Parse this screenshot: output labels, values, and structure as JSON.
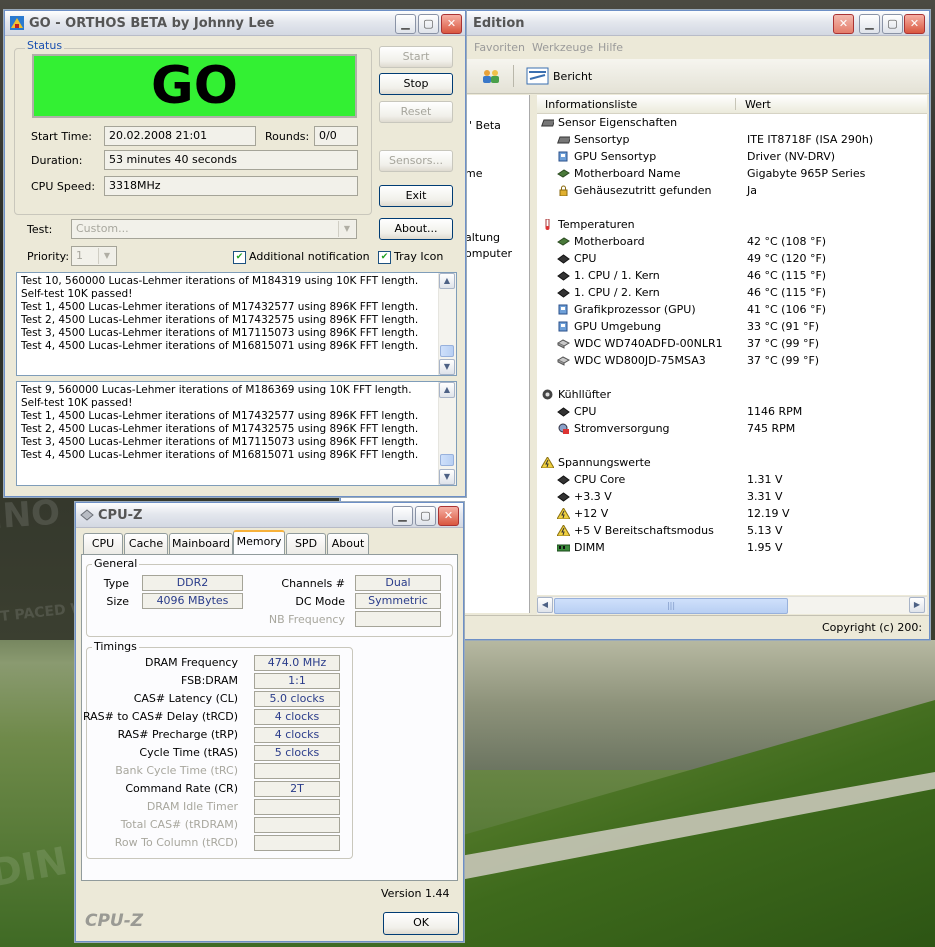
{
  "orthos": {
    "title": "GO - ORTHOS BETA by Johnny Lee",
    "status_label": "Status",
    "status_text": "GO",
    "start_label": "Start Time:",
    "start_value": "20.02.2008 21:01",
    "rounds_label": "Rounds:",
    "rounds_value": "0/0",
    "duration_label": "Duration:",
    "duration_value": "53 minutes 40 seconds",
    "speed_label": "CPU Speed:",
    "speed_value": "3318MHz",
    "buttons": {
      "start": "Start",
      "stop": "Stop",
      "reset": "Reset",
      "sensors": "Sensors...",
      "exit": "Exit",
      "about": "About..."
    },
    "test_label": "Test:",
    "test_value": "Custom...",
    "priority_label": "Priority:",
    "priority_value": "1",
    "notify_label": "Additional notification",
    "tray_label": "Tray Icon",
    "log1": [
      "Test 10, 560000 Lucas-Lehmer iterations of M184319 using 10K FFT length.",
      "Self-test 10K passed!",
      "Test 1, 4500 Lucas-Lehmer iterations of M17432577 using 896K FFT length.",
      "Test 2, 4500 Lucas-Lehmer iterations of M17432575 using 896K FFT length.",
      "Test 3, 4500 Lucas-Lehmer iterations of M17115073 using 896K FFT length.",
      "Test 4, 4500 Lucas-Lehmer iterations of M16815071 using 896K FFT length."
    ],
    "log2": [
      "Test 9, 560000 Lucas-Lehmer iterations of M186369 using 10K FFT length.",
      "Self-test 10K passed!",
      "Test 1, 4500 Lucas-Lehmer iterations of M17432577 using 896K FFT length.",
      "Test 2, 4500 Lucas-Lehmer iterations of M17432575 using 896K FFT length.",
      "Test 3, 4500 Lucas-Lehmer iterations of M17115073 using 896K FFT length.",
      "Test 4, 4500 Lucas-Lehmer iterations of M16815071 using 896K FFT length."
    ]
  },
  "everest": {
    "title_partial": "Edition",
    "menu": [
      "Favoriten",
      "Werkzeuge",
      "Hilfe"
    ],
    "toolbar_report": "Bericht",
    "tree_fragments": [
      "' Beta",
      "me",
      "altung",
      "omputer"
    ],
    "col_item": "Informationsliste",
    "col_value": "Wert",
    "status_copyright": "Copyright (c) 200:",
    "rows": [
      {
        "type": "group",
        "icon": "sensor",
        "label": "Sensor Eigenschaften",
        "value": ""
      },
      {
        "type": "item",
        "icon": "sensor",
        "label": "Sensortyp",
        "value": "ITE IT8718F  (ISA 290h)"
      },
      {
        "type": "item",
        "icon": "gpu",
        "label": "GPU Sensortyp",
        "value": "Driver  (NV-DRV)"
      },
      {
        "type": "item",
        "icon": "board",
        "label": "Motherboard Name",
        "value": "Gigabyte 965P Series"
      },
      {
        "type": "item",
        "icon": "lock",
        "label": "Gehäusezutritt gefunden",
        "value": "Ja"
      },
      {
        "type": "gap"
      },
      {
        "type": "group",
        "icon": "thermo",
        "label": "Temperaturen",
        "value": ""
      },
      {
        "type": "item",
        "icon": "board",
        "label": "Motherboard",
        "value": "42 °C  (108 °F)"
      },
      {
        "type": "item",
        "icon": "cpu",
        "label": "CPU",
        "value": "49 °C  (120 °F)"
      },
      {
        "type": "item",
        "icon": "cpu",
        "label": "1. CPU / 1. Kern",
        "value": "46 °C  (115 °F)"
      },
      {
        "type": "item",
        "icon": "cpu",
        "label": "1. CPU / 2. Kern",
        "value": "46 °C  (115 °F)"
      },
      {
        "type": "item",
        "icon": "gpu",
        "label": "Grafikprozessor (GPU)",
        "value": "41 °C  (106 °F)"
      },
      {
        "type": "item",
        "icon": "gpu",
        "label": "GPU Umgebung",
        "value": "33 °C  (91 °F)"
      },
      {
        "type": "item",
        "icon": "disk",
        "label": "WDC WD740ADFD-00NLR1",
        "value": "37 °C  (99 °F)"
      },
      {
        "type": "item",
        "icon": "disk",
        "label": "WDC WD800JD-75MSA3",
        "value": "37 °C  (99 °F)"
      },
      {
        "type": "gap"
      },
      {
        "type": "group",
        "icon": "fan",
        "label": "Kühllüfter",
        "value": ""
      },
      {
        "type": "item",
        "icon": "cpu",
        "label": "CPU",
        "value": "1146 RPM"
      },
      {
        "type": "item",
        "icon": "psu",
        "label": "Stromversorgung",
        "value": "745 RPM"
      },
      {
        "type": "gap"
      },
      {
        "type": "group",
        "icon": "volt",
        "label": "Spannungswerte",
        "value": ""
      },
      {
        "type": "item",
        "icon": "cpu",
        "label": "CPU Core",
        "value": "1.31 V"
      },
      {
        "type": "item",
        "icon": "cpu",
        "label": "+3.3 V",
        "value": "3.31 V"
      },
      {
        "type": "item",
        "icon": "volt",
        "label": "+12 V",
        "value": "12.19 V"
      },
      {
        "type": "item",
        "icon": "volt",
        "label": "+5 V Bereitschaftsmodus",
        "value": "5.13 V"
      },
      {
        "type": "item",
        "icon": "dimm",
        "label": "DIMM",
        "value": "1.95 V"
      }
    ]
  },
  "cpuz": {
    "title": "CPU-Z",
    "tabs": [
      "CPU",
      "Cache",
      "Mainboard",
      "Memory",
      "SPD",
      "About"
    ],
    "general_label": "General",
    "type_label": "Type",
    "type_value": "DDR2",
    "size_label": "Size",
    "size_value": "4096 MBytes",
    "channels_label": "Channels #",
    "channels_value": "Dual",
    "dcmode_label": "DC Mode",
    "dcmode_value": "Symmetric",
    "nbfreq_label": "NB Frequency",
    "timings_label": "Timings",
    "timings": [
      {
        "label": "DRAM Frequency",
        "value": "474.0 MHz",
        "dim": false
      },
      {
        "label": "FSB:DRAM",
        "value": "1:1",
        "dim": false
      },
      {
        "label": "CAS# Latency (CL)",
        "value": "5.0 clocks",
        "dim": false
      },
      {
        "label": "RAS# to CAS# Delay (tRCD)",
        "value": "4 clocks",
        "dim": false
      },
      {
        "label": "RAS# Precharge (tRP)",
        "value": "4 clocks",
        "dim": false
      },
      {
        "label": "Cycle Time (tRAS)",
        "value": "5 clocks",
        "dim": false
      },
      {
        "label": "Bank Cycle Time (tRC)",
        "value": "",
        "dim": true
      },
      {
        "label": "Command Rate (CR)",
        "value": "2T",
        "dim": false
      },
      {
        "label": "DRAM Idle Timer",
        "value": "",
        "dim": true
      },
      {
        "label": "Total CAS# (tRDRAM)",
        "value": "",
        "dim": true
      },
      {
        "label": "Row To Column (tRCD)",
        "value": "",
        "dim": true
      }
    ],
    "version": "Version 1.44",
    "brand": "CPU-Z",
    "ok": "OK"
  },
  "colors": {
    "go_green": "#33f033",
    "xp_blue": "#003c74",
    "value_blue": "#2a3c8a"
  }
}
